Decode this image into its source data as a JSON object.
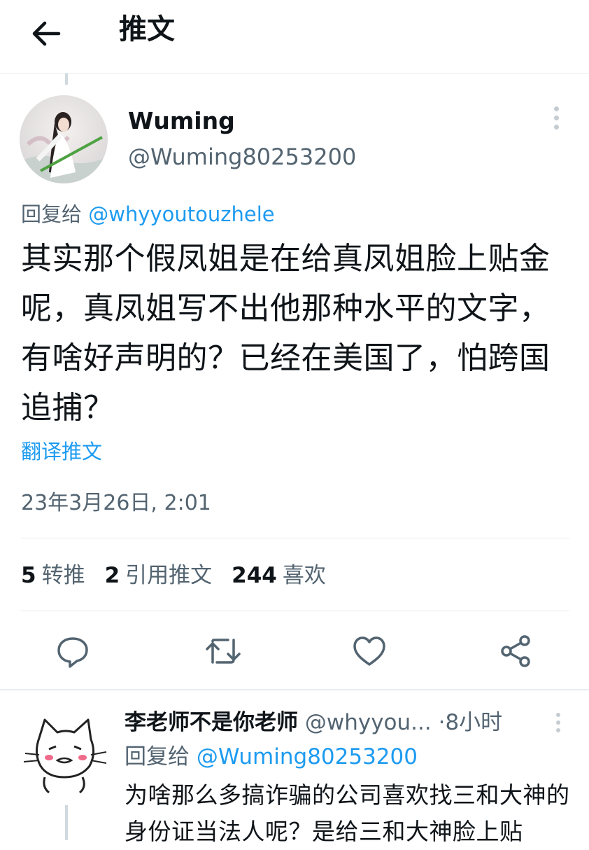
{
  "header": {
    "title": "推文",
    "back_icon": "arrow-left-icon"
  },
  "tweet": {
    "author_name": "Wuming",
    "author_handle": "@Wuming80253200",
    "reply_prefix": "回复给",
    "reply_to": "@whyyoutouzhele",
    "text": "其实那个假凤姐是在给真凤姐脸上贴金呢，真凤姐写不出他那种水平的文字，有啥好声明的？已经在美国了，怕跨国追捕？",
    "translate_label": "翻译推文",
    "timestamp": "23年3月26日, 2:01",
    "stats": {
      "retweets_count": "5",
      "retweets_label": "转推",
      "quotes_count": "2",
      "quotes_label": "引用推文",
      "likes_count": "244",
      "likes_label": "喜欢"
    }
  },
  "actions": [
    "reply-icon",
    "retweet-icon",
    "like-icon",
    "share-icon"
  ],
  "reply": {
    "author_name": "李老师不是你老师",
    "author_handle": "@whyyou...",
    "dot": "·",
    "time": "8小时",
    "reply_prefix": "回复给",
    "reply_to": "@Wuming80253200",
    "text": "为啥那么多搞诈骗的公司喜欢找三和大神的身份证当法人呢？是给三和大神脸上贴"
  },
  "colors": {
    "accent": "#1d9bf0",
    "secondary_text": "#536471",
    "divider": "#e6ecf0",
    "text": "#0f1419"
  }
}
